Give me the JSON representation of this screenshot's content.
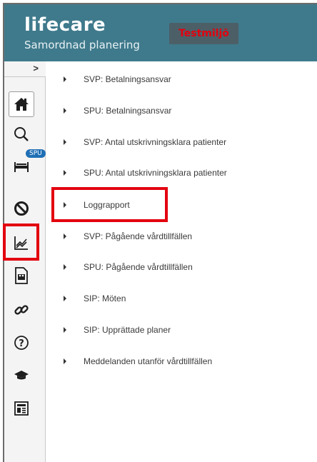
{
  "header": {
    "brand_title": "lifecare",
    "brand_subtitle": "Samordnad planering",
    "environment_badge": "Testmiljö",
    "background_color": "#3f7a8c",
    "badge_text_color": "#e3000f"
  },
  "sidebar": {
    "collapse_glyph": ">",
    "spu_badge": "SPU",
    "items": [
      {
        "icon": "home-icon"
      },
      {
        "icon": "search-icon"
      },
      {
        "icon": "bed-icon"
      },
      {
        "icon": "block-icon"
      },
      {
        "icon": "chart-trend-icon"
      },
      {
        "icon": "report-people-icon"
      },
      {
        "icon": "link-icon"
      },
      {
        "icon": "help-icon"
      },
      {
        "icon": "graduation-cap-icon"
      },
      {
        "icon": "news-icon"
      }
    ]
  },
  "reports": [
    {
      "label": "SVP: Betalningsansvar"
    },
    {
      "label": "SPU: Betalningsansvar"
    },
    {
      "label": "SVP: Antal utskrivningsklara patienter"
    },
    {
      "label": "SPU: Antal utskrivningsklara patienter"
    },
    {
      "label": "Loggrapport"
    },
    {
      "label": "SVP: Pågående vårdtillfällen"
    },
    {
      "label": "SPU: Pågående vårdtillfällen"
    },
    {
      "label": "SIP: Möten"
    },
    {
      "label": "SIP: Upprättade planer"
    },
    {
      "label": "Meddelanden utanför vårdtillfällen"
    }
  ],
  "highlight_color": "#e3000f"
}
